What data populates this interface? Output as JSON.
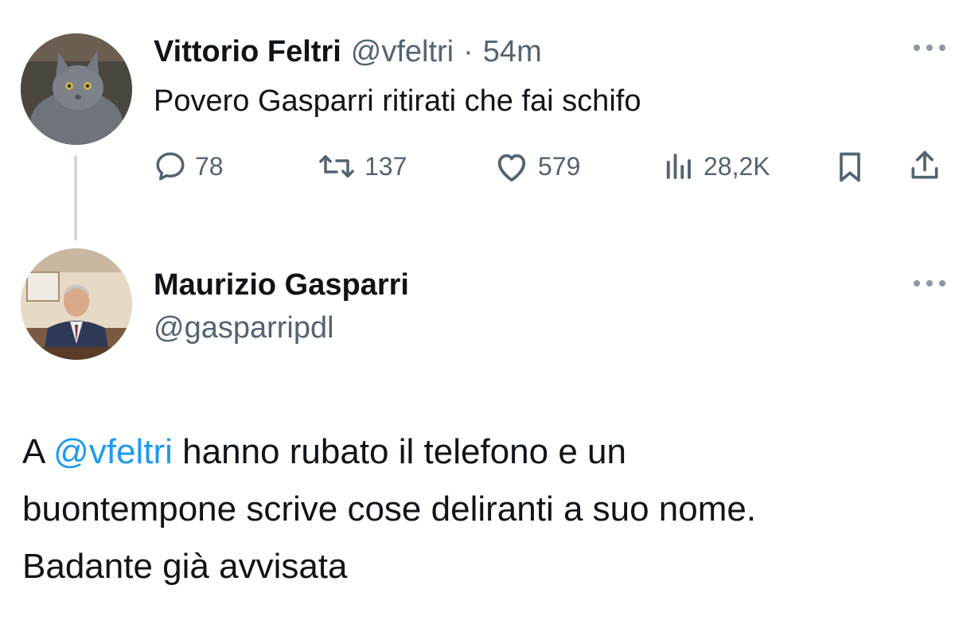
{
  "tweet1": {
    "display_name": "Vittorio Feltri",
    "handle": "@vfeltri",
    "separator": "·",
    "time": "54m",
    "text": "Povero Gasparri ritirati che fai schifo",
    "more_icon": "more-dots-icon",
    "avatar_icon": "cat-avatar",
    "metrics": {
      "replies": "78",
      "retweets": "137",
      "likes": "579",
      "views": "28,2K"
    }
  },
  "tweet2": {
    "display_name": "Maurizio Gasparri",
    "handle": "@gasparripdl",
    "more_icon": "more-dots-icon",
    "avatar_icon": "person-avatar",
    "text_prefix": "A ",
    "mention": "@vfeltri",
    "text_line1_rest": " hanno rubato il telefono e un",
    "text_line2": "buontempone scrive cose deliranti a suo nome.",
    "text_line3": "Badante già avvisata"
  },
  "colors": {
    "text": "#0f1419",
    "muted": "#536471",
    "link": "#1d9bf0",
    "thread_line": "#cfd9de"
  }
}
